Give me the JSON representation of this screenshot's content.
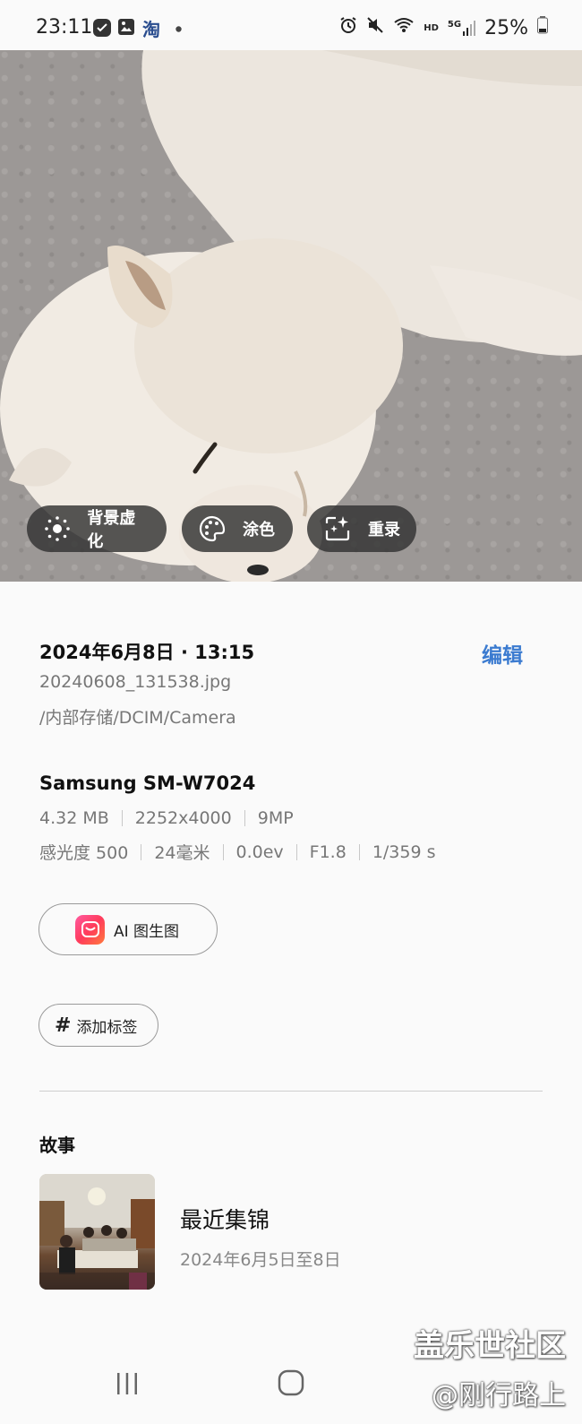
{
  "status_bar": {
    "time": "23:11",
    "app_taobao": "淘",
    "hd": "HD",
    "net": "5G",
    "battery": "25%"
  },
  "photo_actions": {
    "bg_blur": "背景虚化",
    "colorize": "涂色",
    "remaster": "重录"
  },
  "info": {
    "date": "2024年6月8日 · 13:15",
    "edit": "编辑",
    "filename": "20240608_131538.jpg",
    "path": "/内部存储/DCIM/Camera",
    "device": "Samsung SM-W7024",
    "size": "4.32 MB",
    "resolution": "2252x4000",
    "megapixels": "9MP",
    "iso": "感光度 500",
    "focal": "24毫米",
    "ev": "0.0ev",
    "aperture": "F1.8",
    "shutter": "1/359 s"
  },
  "ai_button": "AI 图生图",
  "tag_button": "添加标签",
  "story": {
    "title": "故事",
    "name": "最近集锦",
    "date": "2024年6月5日至8日"
  },
  "watermark": {
    "line1": "盖乐世社区",
    "line2": "@刚行路上"
  },
  "colors": {
    "accent": "#3b7bd0"
  }
}
